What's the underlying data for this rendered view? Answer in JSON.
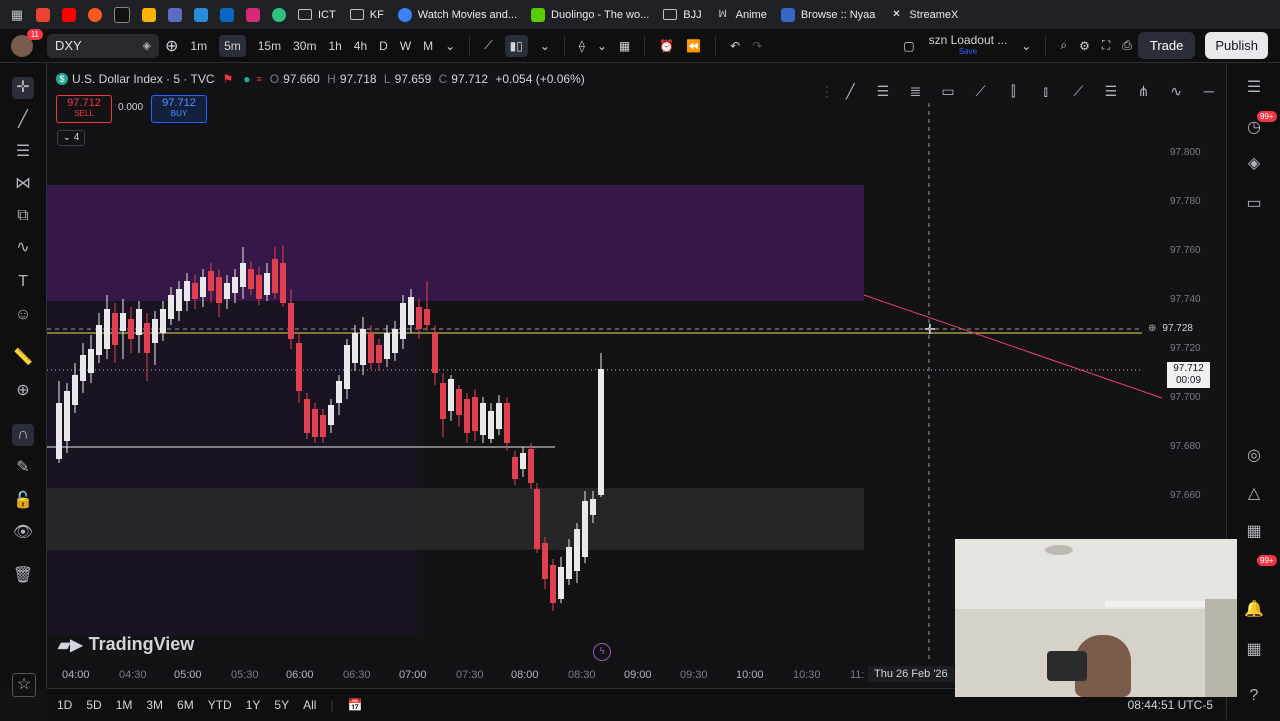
{
  "bookmarks": [
    {
      "label": "ICT"
    },
    {
      "label": "KF"
    },
    {
      "label": "Watch Movies and..."
    },
    {
      "label": "Duolingo - The wo..."
    },
    {
      "label": "BJJ"
    },
    {
      "label": "Anime"
    },
    {
      "label": "Browse :: Nyaa"
    },
    {
      "label": "StreameX"
    }
  ],
  "toolbar": {
    "notification_count": "11",
    "symbol": "DXY",
    "intervals": [
      "1m",
      "5m",
      "15m",
      "30m",
      "1h",
      "4h",
      "D",
      "W",
      "M"
    ],
    "active_interval": "5m",
    "layout_name": "szn Loadout ...",
    "layout_sub": "Save",
    "trade_label": "Trade",
    "publish_label": "Publish"
  },
  "legend": {
    "title": "U.S. Dollar Index · 5 · TVC",
    "o_label": "O",
    "o": "97.660",
    "h_label": "H",
    "h": "97.718",
    "l_label": "L",
    "l": "97.659",
    "c_label": "C",
    "c": "97.712",
    "change": "+0.054 (+0.06%)",
    "sell_price": "97.712",
    "sell_label": "SELL",
    "spread": "0.000",
    "buy_price": "97.712",
    "buy_label": "BUY",
    "indicators_count": "4"
  },
  "price_axis": [
    "97.800",
    "97.780",
    "97.760",
    "97.740",
    "97.720",
    "97.700",
    "97.680",
    "97.660"
  ],
  "crosshair_price": "97.728",
  "last_price": "97.712",
  "bar_countdown": "00:09",
  "time_axis": [
    "04:00",
    "04:30",
    "05:00",
    "05:30",
    "06:00",
    "06:30",
    "07:00",
    "07:30",
    "08:00",
    "08:30",
    "09:00",
    "09:30",
    "10:00",
    "10:30",
    "11:"
  ],
  "crosshair_time": "Thu 26 Feb '26",
  "watermark": "TradingView",
  "ranges": [
    "1D",
    "5D",
    "1M",
    "3M",
    "6M",
    "YTD",
    "1Y",
    "5Y",
    "All"
  ],
  "clock": "08:44:51 UTC-5",
  "right_badges": [
    "99+",
    "99+"
  ],
  "colors": {
    "up": "#e9e9ec",
    "down": "#e0404f",
    "zone_purple": "#3b1a4e",
    "zone_gray": "#2a2a2d",
    "hline": "#e6e04a",
    "trend": "#f0436a"
  }
}
